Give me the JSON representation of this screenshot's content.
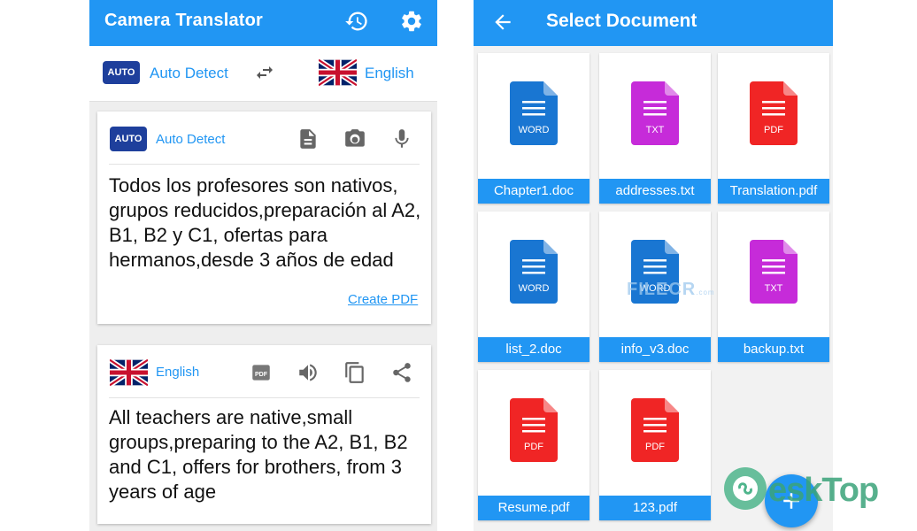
{
  "left": {
    "appbar": {
      "title": "Camera Translator",
      "icons": [
        "history-icon",
        "gear-icon"
      ]
    },
    "lang_bar": {
      "source_badge": "AUTO",
      "source_label": "Auto Detect",
      "swap_icon": "swap-icon",
      "target_label": "English"
    },
    "source_card": {
      "badge": "AUTO",
      "label": "Auto Detect",
      "tools": [
        "document-icon",
        "camera-icon",
        "mic-icon"
      ],
      "text": "Todos los profesores son nativos, grupos reducidos,preparación al A2, B1, B2 y C1, ofertas para hermanos,desde 3 años de edad",
      "link": "Create PDF"
    },
    "target_card": {
      "label": "English",
      "tools": [
        "pdf-icon",
        "speaker-icon",
        "copy-icon",
        "share-icon"
      ],
      "text": "All teachers are native,small groups,preparing to the A2, B1, B2 and C1, offers for brothers, from 3 years of age"
    }
  },
  "right": {
    "appbar": {
      "title": "Select Document",
      "back_icon": "back-arrow-icon"
    },
    "files": [
      {
        "name": "Chapter1.doc",
        "type": "WORD",
        "color": "#1976d2"
      },
      {
        "name": "addresses.txt",
        "type": "TXT",
        "color": "#c62bd9"
      },
      {
        "name": "Translation.pdf",
        "type": "PDF",
        "color": "#f02525"
      },
      {
        "name": "list_2.doc",
        "type": "WORD",
        "color": "#1976d2"
      },
      {
        "name": "info_v3.doc",
        "type": "WORD",
        "color": "#1976d2"
      },
      {
        "name": "backup.txt",
        "type": "TXT",
        "color": "#c62bd9"
      },
      {
        "name": "Resume.pdf",
        "type": "PDF",
        "color": "#f02525"
      },
      {
        "name": "123.pdf",
        "type": "PDF",
        "color": "#f02525"
      }
    ],
    "fab_icon": "plus-icon"
  },
  "watermarks": {
    "brand": "eskTop",
    "center": "FILECR",
    "center_suffix": ".com"
  }
}
